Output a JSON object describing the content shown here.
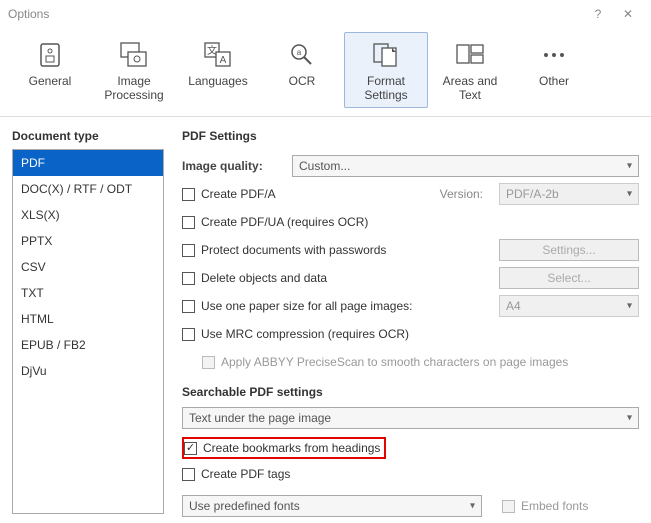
{
  "window": {
    "title": "Options"
  },
  "toolbar": {
    "items": [
      {
        "label": "General"
      },
      {
        "label": "Image\nProcessing"
      },
      {
        "label": "Languages"
      },
      {
        "label": "OCR"
      },
      {
        "label": "Format\nSettings"
      },
      {
        "label": "Areas and Text"
      },
      {
        "label": "Other"
      }
    ],
    "active_index": 4
  },
  "left": {
    "title": "Document type",
    "items": [
      "PDF",
      "DOC(X) / RTF / ODT",
      "XLS(X)",
      "PPTX",
      "CSV",
      "TXT",
      "HTML",
      "EPUB / FB2",
      "DjVu"
    ],
    "selected_index": 0
  },
  "pdf": {
    "section_title": "PDF Settings",
    "image_quality_label": "Image quality:",
    "image_quality_value": "Custom...",
    "create_pdfa": "Create PDF/A",
    "version_label": "Version:",
    "version_value": "PDF/A-2b",
    "create_pdfua": "Create PDF/UA (requires OCR)",
    "protect": "Protect documents with passwords",
    "settings_btn": "Settings...",
    "delete_obj": "Delete objects and data",
    "select_btn": "Select...",
    "one_paper": "Use one paper size for all page images:",
    "paper_value": "A4",
    "mrc": "Use MRC compression (requires OCR)",
    "precisescan": "Apply ABBYY PreciseScan to smooth characters on page images",
    "searchable_title": "Searchable PDF settings",
    "searchable_mode": "Text under the page image",
    "bookmarks": "Create bookmarks from headings",
    "tags": "Create PDF tags",
    "fonts_mode": "Use predefined fonts",
    "embed_fonts": "Embed fonts"
  }
}
